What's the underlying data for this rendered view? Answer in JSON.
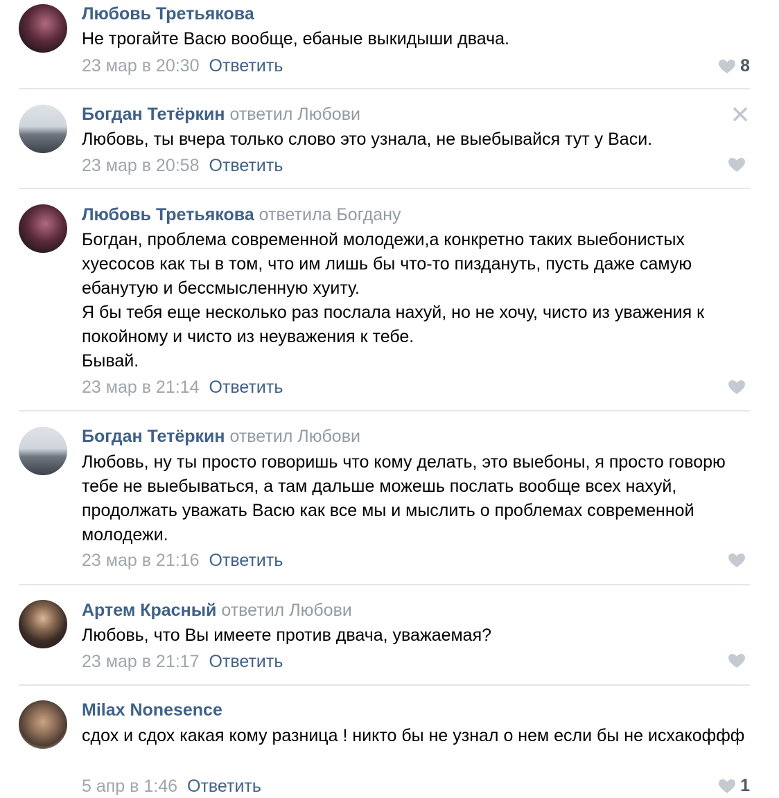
{
  "comments": [
    {
      "author": "Любовь Третьякова",
      "reply_to": "",
      "text": "Не трогайте Васю вообще, ебаные выкидыши двача.",
      "date": "23 мар в 20:30",
      "reply_label": "Ответить",
      "likes": "8"
    },
    {
      "author": "Богдан Тетёркин",
      "reply_to": "ответил Любови",
      "text": "Любовь, ты вчера только слово это узнала, не выебывайся тут у Васи.",
      "date": "23 мар в 20:58",
      "reply_label": "Ответить",
      "likes": ""
    },
    {
      "author": "Любовь Третьякова",
      "reply_to": "ответила Богдану",
      "text": "Богдан, проблема современной молодежи,а конкретно таких выебонистых хуесосов как ты в том, что им лишь бы что-то пиздануть, пусть даже самую ебанутую и бессмысленную хуиту.\nЯ бы тебя еще несколько раз послала нахуй, но не хочу, чисто из уважения к покойному и чисто из неуважения к тебе.\nБывай.",
      "date": "23 мар в 21:14",
      "reply_label": "Ответить",
      "likes": ""
    },
    {
      "author": "Богдан Тетёркин",
      "reply_to": "ответил Любови",
      "text": "Любовь, ну ты просто говоришь что кому делать, это выебоны, я просто говорю тебе не выебываться, а там дальше можешь послать вообще всех нахуй, продолжать уважать Васю как все мы и мыслить о проблемах современной молодежи.",
      "date": "23 мар в 21:16",
      "reply_label": "Ответить",
      "likes": ""
    },
    {
      "author": "Артем Красный",
      "reply_to": "ответил Любови",
      "text": "Любовь, что Вы имеете против двача, уважаемая?",
      "date": "23 мар в 21:17",
      "reply_label": "Ответить",
      "likes": ""
    },
    {
      "author": "Milax Nonesence",
      "reply_to": "",
      "text": "сдох и сдох какая кому разница ! никто бы не узнал о нем если бы не исхакоффф",
      "date": "5 апр в 1:46",
      "reply_label": "Ответить",
      "likes": "1"
    }
  ],
  "icons": {
    "heart": "heart-icon",
    "close": "close-icon"
  },
  "colors": {
    "author": "#3f6189",
    "meta": "#a0a6ad",
    "reply_to": "#939ba5",
    "heart": "#c5cad1"
  }
}
